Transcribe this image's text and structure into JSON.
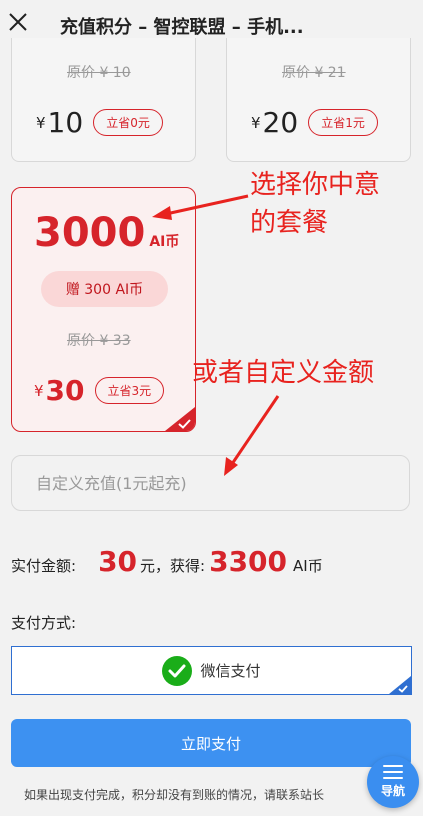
{
  "header": {
    "title": "充值积分 – 智控联盟 – 手机..."
  },
  "packages": [
    {
      "original_price": "原价 ¥ 10",
      "yen": "¥",
      "price": "10",
      "save": "立省0元"
    },
    {
      "original_price": "原价 ¥ 21",
      "yen": "¥",
      "price": "20",
      "save": "立省1元"
    },
    {
      "coins": "3000",
      "coins_unit": "AI币",
      "bonus": "赠 300 AI币",
      "original_price": "原价 ¥ 33",
      "yen": "¥",
      "price": "30",
      "save": "立省3元",
      "selected": true
    }
  ],
  "custom": {
    "placeholder": "自定义充值(1元起充)"
  },
  "payment": {
    "label": "实付金额:",
    "amount": "30",
    "amount_suffix": "元，获得:",
    "coins": "3300",
    "coins_unit": "AI币"
  },
  "method": {
    "label": "支付方式:",
    "wechat": "微信支付"
  },
  "pay_button": "立即支付",
  "footer": "如果出现支付完成，积分却没有到账的情况，请联系站长",
  "nav": {
    "label": "导航"
  },
  "annotations": {
    "line1": "选择你中意",
    "line2": "的套餐",
    "line3": "或者自定义金额"
  },
  "colors": {
    "accent_red": "#d6242b",
    "button_blue": "#3d91f1",
    "wechat_green": "#1aad19",
    "annotation_red": "#e8231f"
  }
}
